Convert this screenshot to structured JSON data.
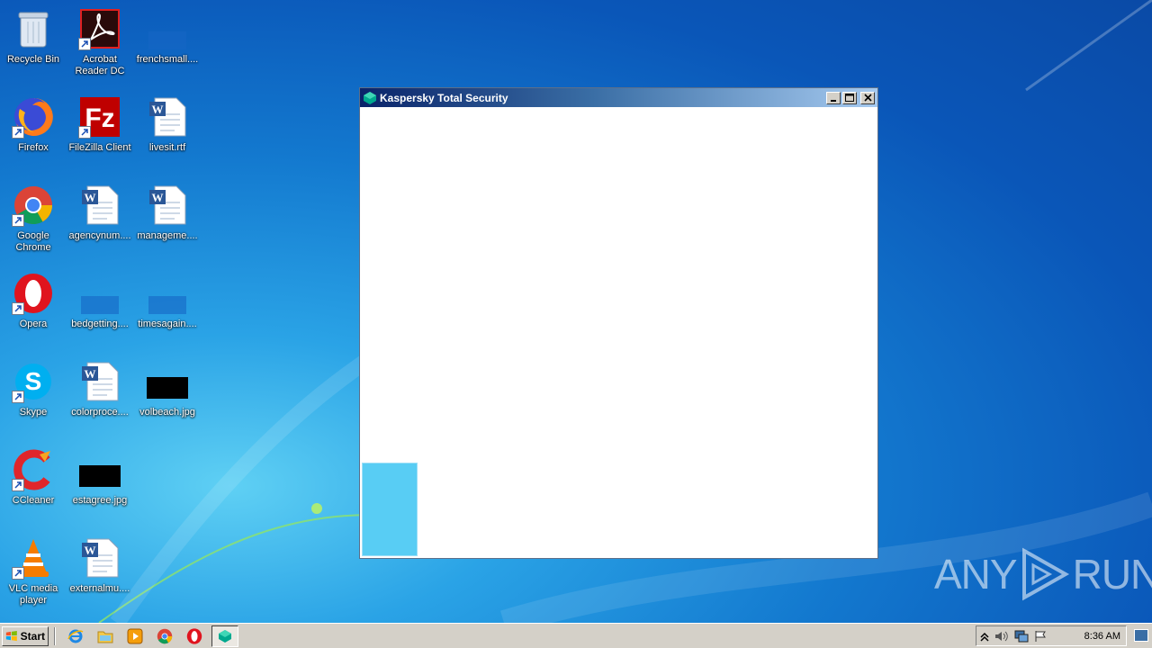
{
  "desktop": {
    "icons": [
      {
        "label": "Recycle Bin",
        "icon": "recycle-bin-icon"
      },
      {
        "label": "Acrobat Reader DC",
        "icon": "acrobat-reader-icon"
      },
      {
        "label": "frenchsmall....",
        "icon": "file-icon"
      },
      {
        "label": "Firefox",
        "icon": "firefox-icon"
      },
      {
        "label": "FileZilla Client",
        "icon": "filezilla-icon"
      },
      {
        "label": "livesit.rtf",
        "icon": "word-document-icon"
      },
      {
        "label": "Google Chrome",
        "icon": "chrome-icon"
      },
      {
        "label": "agencynum....",
        "icon": "word-document-icon"
      },
      {
        "label": "manageme....",
        "icon": "word-document-icon"
      },
      {
        "label": "Opera",
        "icon": "opera-icon"
      },
      {
        "label": "bedgetting....",
        "icon": "file-icon"
      },
      {
        "label": "timesagain....",
        "icon": "file-icon"
      },
      {
        "label": "Skype",
        "icon": "skype-icon"
      },
      {
        "label": "colorproce....",
        "icon": "word-document-icon"
      },
      {
        "label": "volbeach.jpg",
        "icon": "image-thumbnail-icon"
      },
      {
        "label": "CCleaner",
        "icon": "ccleaner-icon"
      },
      {
        "label": "estagree.jpg",
        "icon": "image-thumbnail-icon"
      },
      {
        "label": "VLC media player",
        "icon": "vlc-icon"
      },
      {
        "label": "externalmu....",
        "icon": "word-document-icon"
      }
    ]
  },
  "window": {
    "title": "Kaspersky Total Security",
    "icon": "kaspersky-icon"
  },
  "watermark": {
    "left": "ANY",
    "right": "RUN"
  },
  "taskbar": {
    "start_label": "Start",
    "quick_launch": [
      "internet-explorer-icon",
      "explorer-folder-icon",
      "media-player-icon",
      "chrome-icon",
      "opera-icon"
    ],
    "active_task_icon": "kaspersky-icon",
    "clock": "8:36 AM"
  },
  "colors": {
    "accent": "#0a246a",
    "desktop_blue": "#1379cf",
    "splash_cyan": "#58cdf4"
  }
}
